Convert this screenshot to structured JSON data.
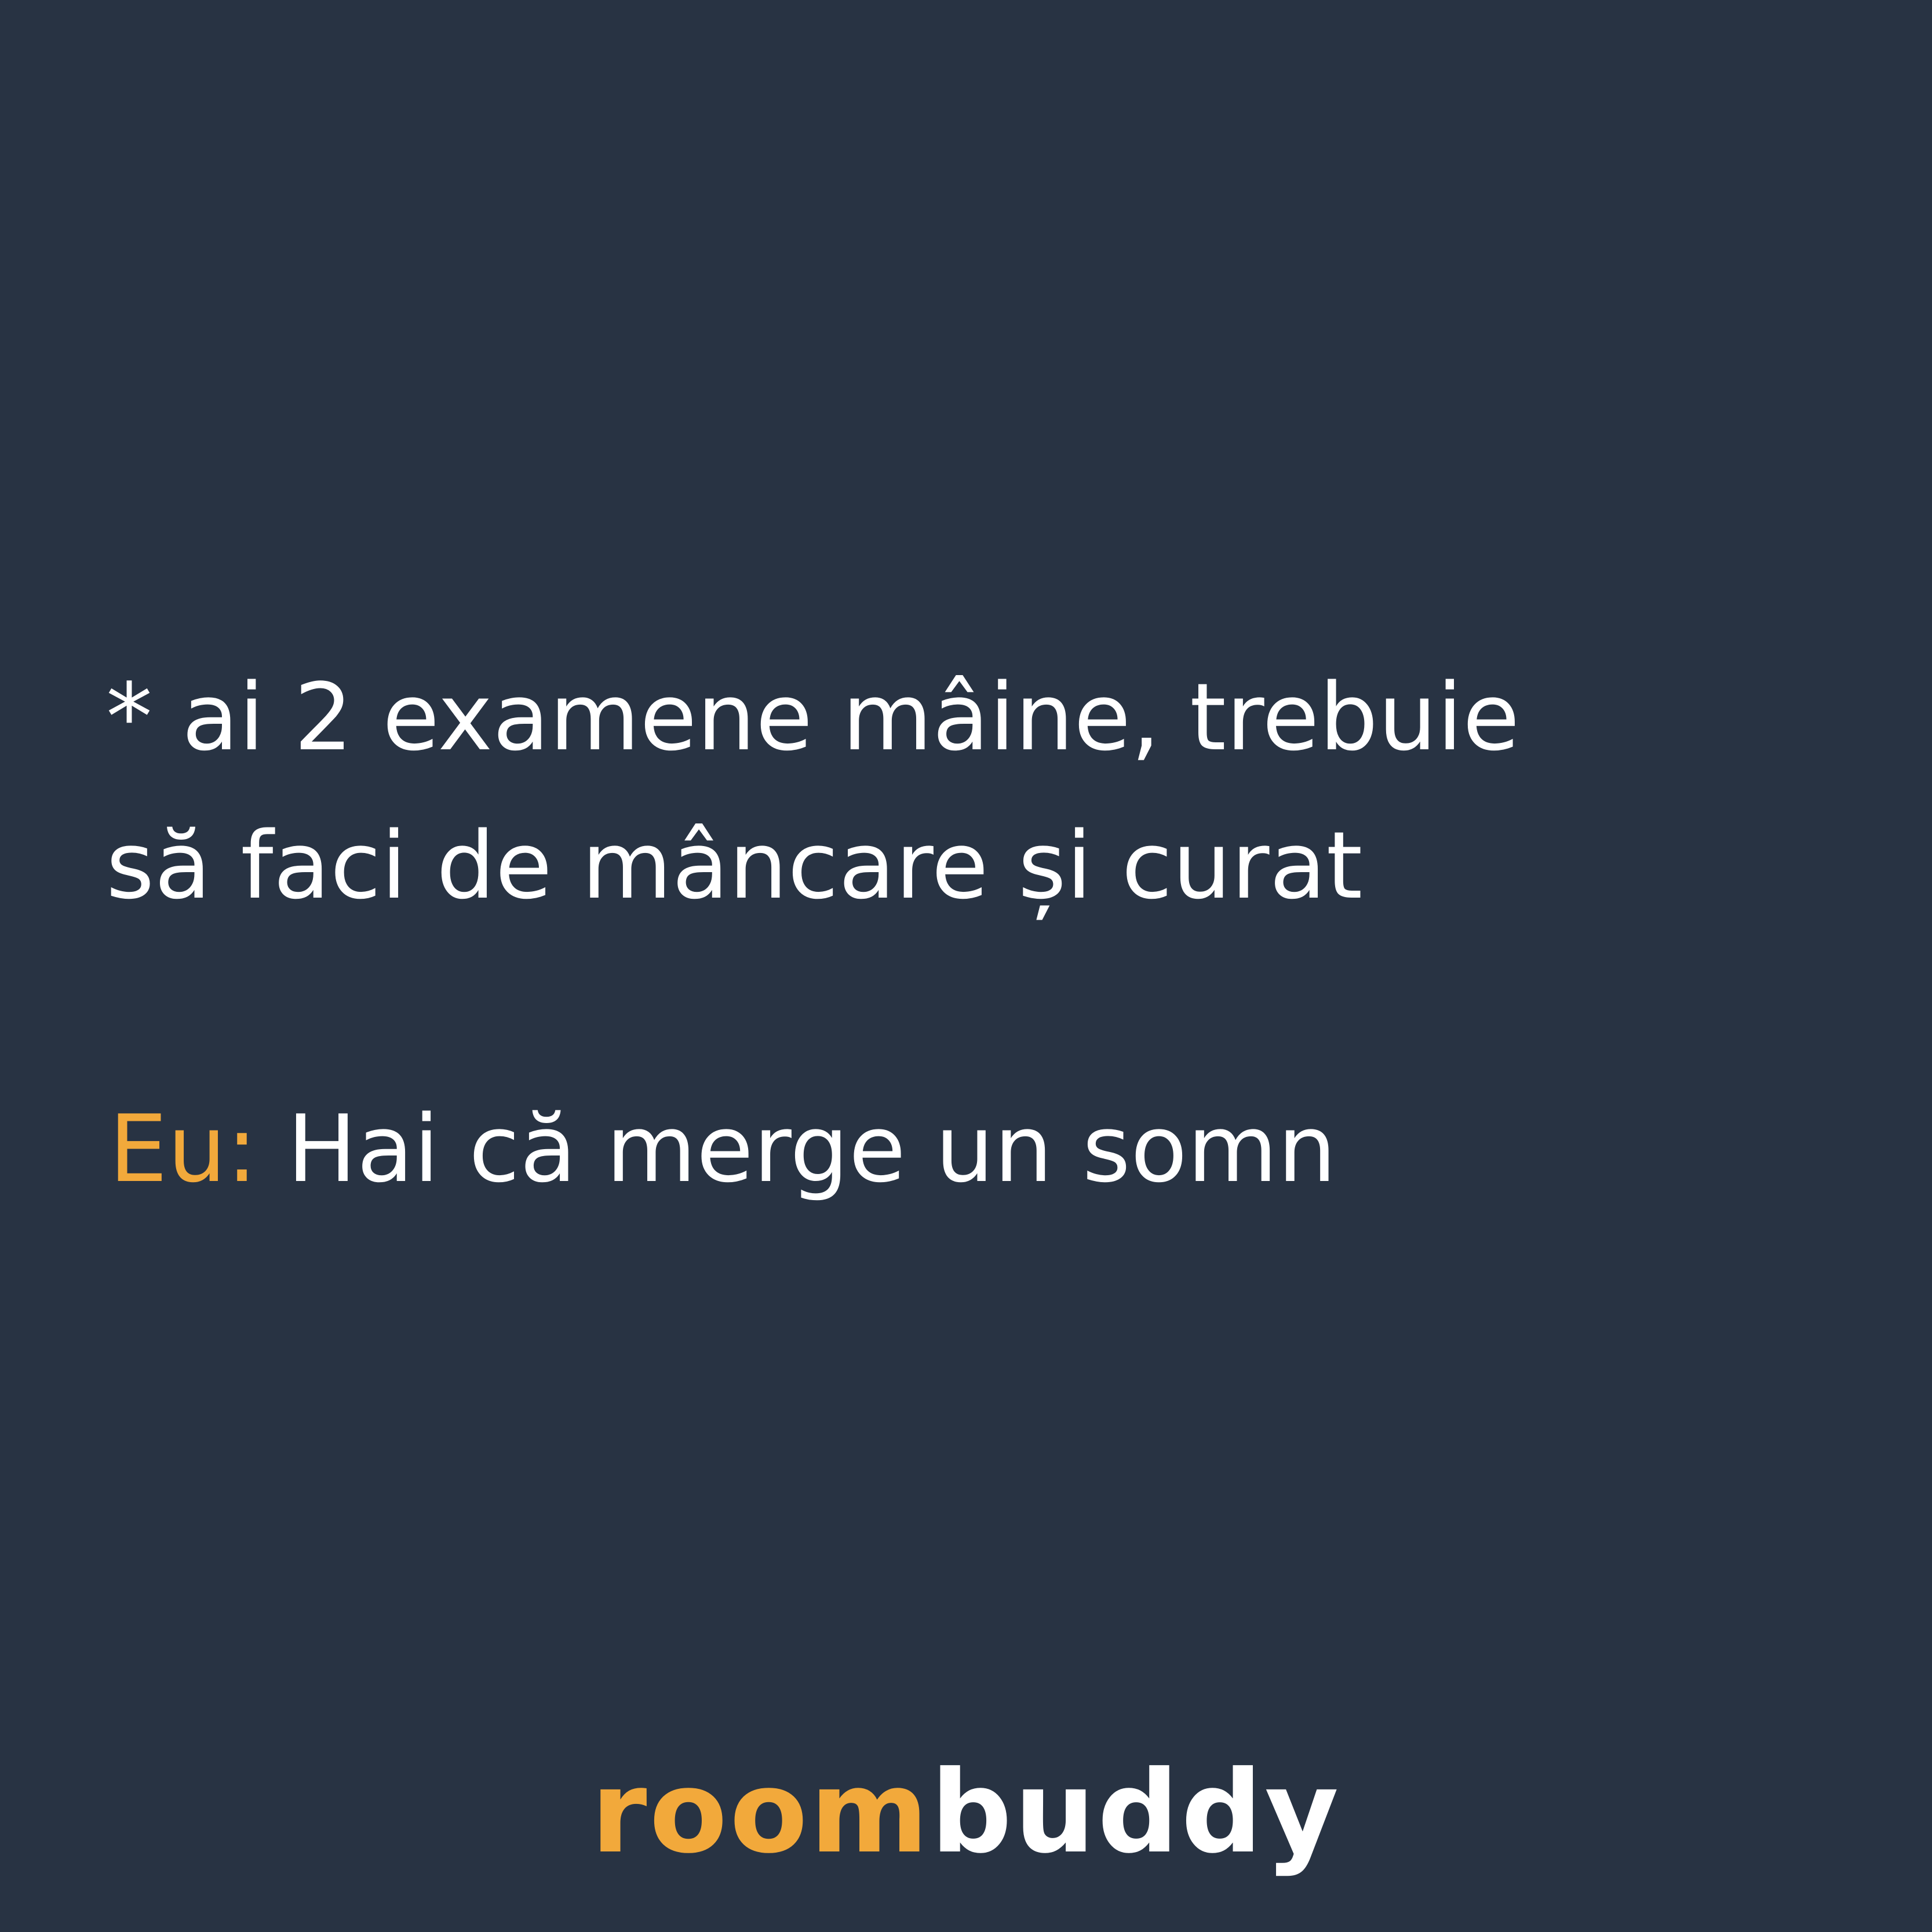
{
  "post": {
    "setup_line_1": "* ai 2 examene mâine, trebuie",
    "setup_line_2": "să faci de mâncare și curat",
    "speaker": "Eu:",
    "punchline": "Hai că merge un somn"
  },
  "brand": {
    "part_1": "room",
    "part_2": "buddy"
  },
  "colors": {
    "background": "#283343",
    "text": "#ffffff",
    "accent": "#f2a93b"
  }
}
